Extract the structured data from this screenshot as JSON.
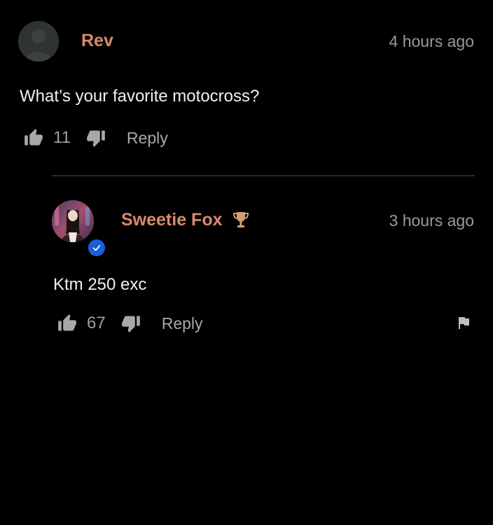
{
  "comments": [
    {
      "username": "Rev",
      "timestamp": "4 hours ago",
      "text": "What’s your favorite motocross?",
      "likes": "11",
      "reply_label": "Reply"
    },
    {
      "username": "Sweetie Fox",
      "timestamp": "3 hours ago",
      "text": "Ktm 250 exc",
      "likes": "67",
      "reply_label": "Reply",
      "verified": true,
      "badge": "trophy-icon"
    }
  ],
  "colors": {
    "background": "#000000",
    "username": "#d98a6b",
    "muted": "#9a9a9a",
    "verified": "#1a5fd6"
  }
}
